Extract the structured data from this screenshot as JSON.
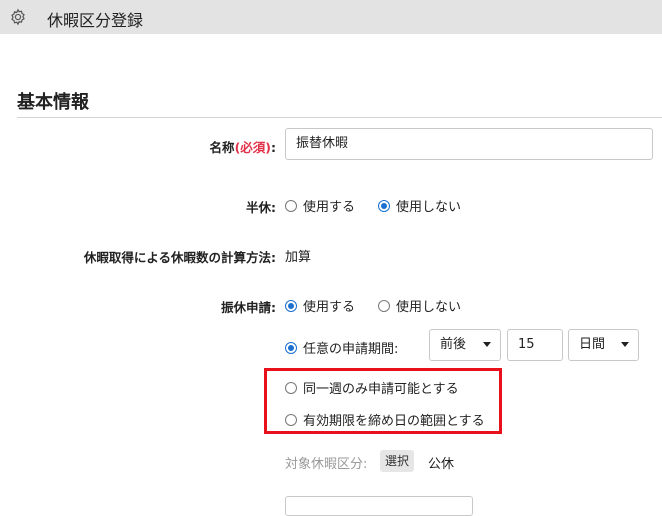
{
  "window": {
    "title": "休暇区分登録",
    "icon": "gear-icon"
  },
  "section": {
    "title": "基本情報"
  },
  "form": {
    "name": {
      "label": "名称",
      "required": "(必須)",
      "colon": ":",
      "value": "振替休暇"
    },
    "half_day": {
      "label": "半休:",
      "options": [
        {
          "label": "使用する",
          "selected": false
        },
        {
          "label": "使用しない",
          "selected": true
        }
      ]
    },
    "calc_method": {
      "label": "休暇取得による休暇数の計算方法:",
      "value": "加算"
    },
    "furikyu": {
      "label": "振休申請:",
      "options": [
        {
          "label": "使用する",
          "selected": true
        },
        {
          "label": "使用しない",
          "selected": false
        }
      ],
      "period_option": {
        "label": "任意の申請期間:",
        "selected": true
      },
      "period_direction": "前後",
      "period_number": "15",
      "period_unit": "日間",
      "same_week_option": {
        "label": "同一週のみ申請可能とする",
        "selected": false
      },
      "expiry_option": {
        "label": "有効期限を締め日の範囲とする",
        "selected": false
      }
    },
    "target": {
      "label": "対象休暇区分:",
      "button": "選択",
      "value": "公休"
    }
  },
  "colors": {
    "accent": "#1a6fd1",
    "required": "#e0334a",
    "highlight": "#e8101a",
    "titlebar": "#e3e3e3"
  }
}
